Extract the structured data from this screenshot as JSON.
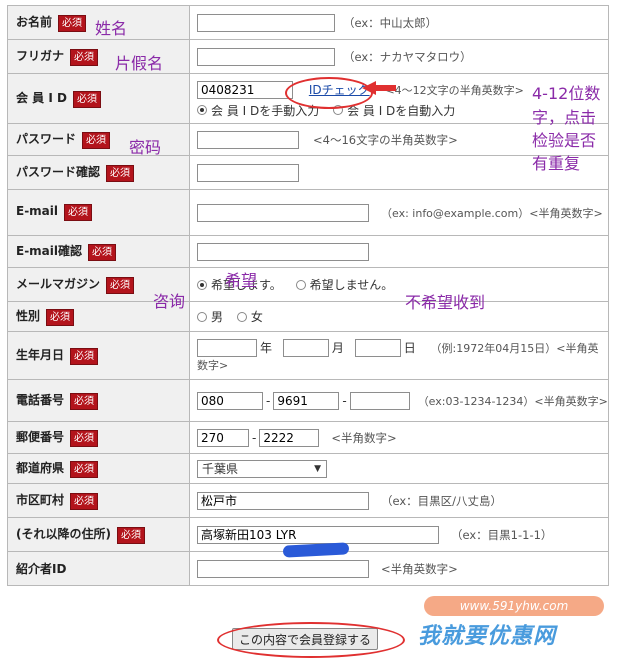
{
  "required_label": "必須",
  "rows": {
    "name": {
      "label": "お名前",
      "hint": "（ex：中山太郎）"
    },
    "furigana": {
      "label": "フリガナ",
      "hint": "（ex：ナカヤマタロウ）"
    },
    "member_id": {
      "label": "会 員 I D",
      "value": "0408231",
      "check_link": "IDチェック",
      "hint": "<4〜12文字の半角英数字>",
      "radio_manual": "会 員 I Dを手動入力",
      "radio_auto": "会 員 I Dを自動入力"
    },
    "password": {
      "label": "パスワード",
      "hint": "<4〜16文字の半角英数字>"
    },
    "password_confirm": {
      "label": "パスワード確認"
    },
    "email": {
      "label": "E-mail",
      "hint": "（ex: info@example.com）<半角英数字>"
    },
    "email_confirm": {
      "label": "E-mail確認"
    },
    "magazine": {
      "label": "メールマガジン",
      "opt_yes": "希望します。",
      "opt_no": "希望しません。"
    },
    "gender": {
      "label": "性別",
      "opt_male": "男",
      "opt_female": "女"
    },
    "birthday": {
      "label": "生年月日",
      "year": "年",
      "month": "月",
      "day": "日",
      "hint": "（例:1972年04月15日）<半角英数字>"
    },
    "phone": {
      "label": "電話番号",
      "p1": "080",
      "p2": "9691",
      "p3": "",
      "dash": "-",
      "hint": "（ex:03-1234-1234）<半角英数字>"
    },
    "postal": {
      "label": "郵便番号",
      "p1": "270",
      "p2": "2222",
      "dash": "-",
      "hint": "<半角数字>"
    },
    "prefecture": {
      "label": "都道府県",
      "value": "千葉県"
    },
    "city": {
      "label": "市区町村",
      "value": "松戸市",
      "hint": "（ex：目黒区/八丈島）"
    },
    "address": {
      "label": "(それ以降の住所)",
      "value": "高塚新田103 LYR",
      "hint": "（ex：目黒1-1-1）"
    },
    "referrer": {
      "label": "紹介者ID",
      "hint": "<半角英数字>"
    }
  },
  "submit_label": "この内容で会員登録する",
  "annotations": {
    "name": "姓名",
    "furigana": "片假名",
    "password": "密码",
    "id_note_1": "4-12位数",
    "id_note_2": "字，点击",
    "id_note_3": "检验是否",
    "id_note_4": "有重复",
    "hope": "希望",
    "consult": "咨询",
    "no_hope": "不希望收到"
  },
  "watermark": {
    "url": "www.591yhw.com",
    "text": "我就要优惠网"
  },
  "colors": {
    "required_bg": "#b3141c",
    "annotation": "#8a2aa8",
    "ellipse": "#e03030",
    "watermark": "#2a8ad8"
  }
}
